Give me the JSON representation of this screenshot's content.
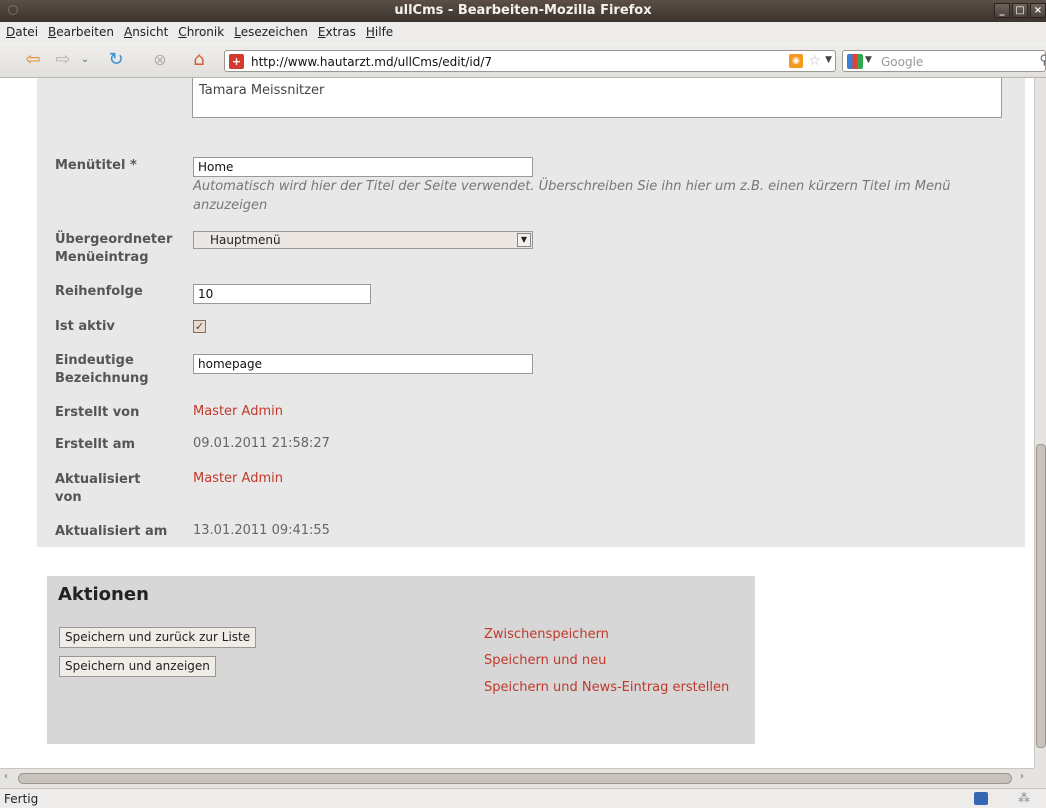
{
  "window": {
    "title": "ullCms - Bearbeiten-Mozilla Firefox",
    "buttons": [
      "_",
      "□",
      "×"
    ]
  },
  "menu": [
    "Datei",
    "Bearbeiten",
    "Ansicht",
    "Chronik",
    "Lesezeichen",
    "Extras",
    "Hilfe"
  ],
  "navbar": {
    "url": "http://www.hautarzt.md/ullCms/edit/id/7",
    "search_placeholder": "Google"
  },
  "form": {
    "name_value": "Tamara Meissnitzer",
    "menutitel_label": "Menütitel *",
    "menutitel_value": "Home",
    "menutitel_hint": "Automatisch wird hier der Titel der Seite verwendet. Überschreiben Sie ihn hier um z.B. einen kürzern Titel im Menü anzuzeigen",
    "parent_label": "Übergeordneter Menüeintrag",
    "parent_value": "Hauptmenü",
    "order_label": "Reihenfolge",
    "order_value": "10",
    "active_label": "Ist aktiv",
    "active_checked": true,
    "slug_label": "Eindeutige Bezeichnung",
    "slug_value": "homepage",
    "created_by_label": "Erstellt von",
    "created_by_value": "Master Admin",
    "created_at_label": "Erstellt am",
    "created_at_value": "09.01.2011 21:58:27",
    "updated_by_label": "Aktualisiert von",
    "updated_by_value": "Master Admin",
    "updated_at_label": "Aktualisiert am",
    "updated_at_value": "13.01.2011 09:41:55"
  },
  "actions": {
    "title": "Aktionen",
    "buttons": [
      "Speichern und zurück zur Liste",
      "Speichern und anzeigen"
    ],
    "links": [
      "Zwischenspeichern",
      "Speichern und neu",
      "Speichern und News-Eintrag erstellen"
    ]
  },
  "status": {
    "text": "Fertig"
  }
}
